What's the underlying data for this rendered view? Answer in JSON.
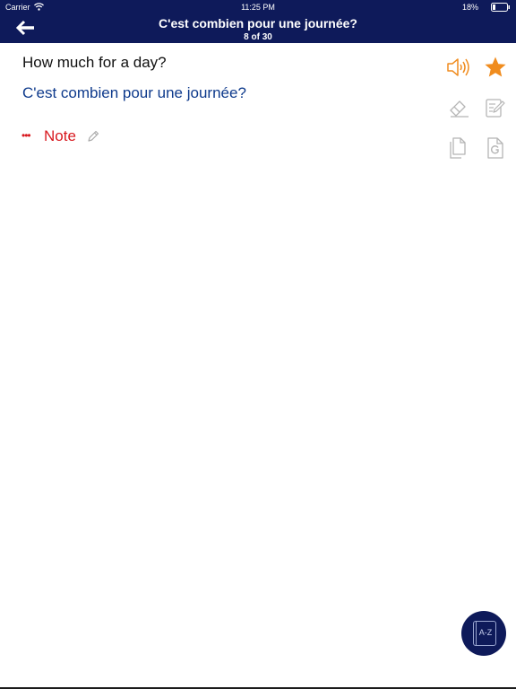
{
  "status_bar": {
    "carrier": "Carrier",
    "time": "11:25 PM",
    "battery": "18%"
  },
  "nav": {
    "title": "C'est combien pour une journée?",
    "subtitle": "8 of 30"
  },
  "phrase": {
    "english": "How much for a day?",
    "french": "C'est combien pour une journée?"
  },
  "note": {
    "dots": "•••",
    "label": "Note"
  },
  "actions": {
    "az_label": "A-Z"
  },
  "colors": {
    "header_bg": "#0e1a5a",
    "french_text": "#0e3a8c",
    "note_red": "#d8191f",
    "accent_orange": "#f08c1e",
    "icon_gray": "#b5b5b5"
  }
}
